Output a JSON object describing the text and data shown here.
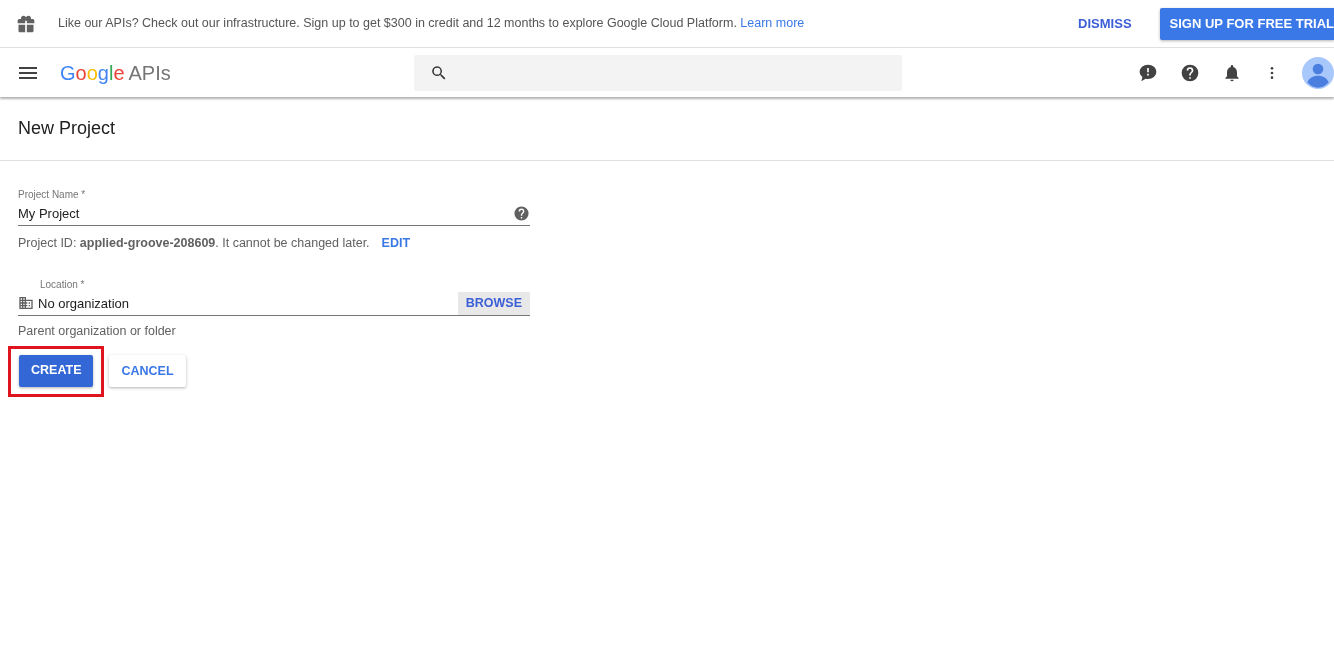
{
  "banner": {
    "message": "Like our APIs? Check out our infrastructure. Sign up to get $300 in credit and 12 months to explore Google Cloud Platform.",
    "link": "Learn more",
    "dismiss": "DISMISS",
    "signup": "SIGN UP FOR FREE TRIAL"
  },
  "header": {
    "logo": "Google",
    "product": "APIs"
  },
  "page_title": "New Project",
  "form": {
    "project_name": {
      "label": "Project Name *",
      "value": "My Project"
    },
    "project_id_hint": "Project ID: **applied-groove-208609**. It cannot be changed later.",
    "edit_link": "EDIT",
    "location": {
      "label": "Location *",
      "value": "No organization",
      "browse": "BROWSE",
      "hint": "Parent organization or folder"
    },
    "buttons": [
      {
        "kind": "primary",
        "label": "CREATE",
        "highlighted": true
      },
      {
        "kind": "secondary",
        "label": "CANCEL",
        "highlighted": false
      }
    ]
  }
}
